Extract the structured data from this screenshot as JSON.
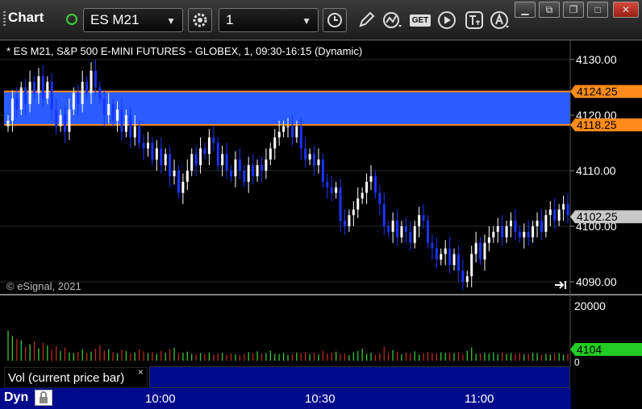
{
  "toolbar": {
    "title": "Chart",
    "symbol": "ES M21",
    "interval": "1",
    "icons": [
      "gear-icon",
      "clock-icon",
      "pencil-icon",
      "study-icon",
      "get-icon",
      "play-icon",
      "text-icon",
      "alert-icon"
    ],
    "get_label": "GET"
  },
  "chart_header": "* ES M21, S&P 500 E-MINI FUTURES - GLOBEX, 1, 09:30-16:15 (Dynamic)",
  "watermark": "© eSignal, 2021",
  "price_axis": [
    "4130.00",
    "4120.00",
    "4110.00",
    "4100.00",
    "4090.00"
  ],
  "price_tags": {
    "upper": "4124.25",
    "lower": "4118.25",
    "last": "4102.25"
  },
  "volume_axis": {
    "top": "20000",
    "zero": "0",
    "last": "4104"
  },
  "volume_panel_label": "Vol (current price bar)",
  "close_glyph": "×",
  "bottom": {
    "mode": "Dyn",
    "times": [
      "10:00",
      "10:30",
      "11:00"
    ]
  },
  "colors": {
    "band": "#2a5cff",
    "band_line": "#ff8c1a",
    "up": "#ffffff",
    "down": "#1a33ff",
    "vol_up": "#39c93a",
    "vol_down": "#c0281e",
    "last_tag": "#c8c8c8",
    "vol_tag": "#22cc22"
  },
  "chart_data": {
    "type": "candlestick",
    "ylim": [
      4088,
      4133
    ],
    "band": [
      4118.25,
      4124.25
    ],
    "volume_ylim": [
      0,
      20000
    ],
    "closes": [
      4119,
      4123,
      4121,
      4125,
      4122,
      4126,
      4124,
      4127,
      4123,
      4126,
      4121,
      4118,
      4120,
      4117,
      4121,
      4124,
      4122,
      4126,
      4124,
      4128,
      4125,
      4123,
      4120,
      4122,
      4119,
      4121,
      4117,
      4120,
      4116,
      4118,
      4115,
      4114,
      4115,
      4112,
      4114,
      4111,
      4113,
      4109,
      4110,
      4106,
      4108,
      4110,
      4113,
      4111,
      4114,
      4113,
      4116,
      4115,
      4111,
      4113,
      4110,
      4109,
      4112,
      4110,
      4108,
      4111,
      4109,
      4111,
      4110,
      4112,
      4114,
      4116,
      4117,
      4118,
      4118,
      4116,
      4118,
      4114,
      4112,
      4113,
      4111,
      4112,
      4108,
      4107,
      4106,
      4107,
      4101,
      4100,
      4102,
      4103,
      4105,
      4106,
      4108,
      4109,
      4106,
      4104,
      4100,
      4099,
      4101,
      4098,
      4100,
      4099,
      4097,
      4100,
      4102,
      4101,
      4097,
      4096,
      4094,
      4095,
      4096,
      4093,
      4095,
      4092,
      4090,
      4091,
      4095,
      4097,
      4094,
      4097,
      4098,
      4099,
      4100,
      4098,
      4100,
      4101,
      4099,
      4098,
      4099,
      4098,
      4100,
      4101,
      4099,
      4102,
      4103,
      4101,
      4103,
      4104,
      4102
    ],
    "volumes": [
      11000,
      9000,
      8000,
      7500,
      5000,
      6000,
      7000,
      4500,
      6500,
      5500,
      4000,
      5200,
      3600,
      4800,
      3000,
      2800,
      3200,
      4200,
      2900,
      3300,
      4400,
      5600,
      3800,
      4200,
      3100,
      2700,
      3900,
      3500,
      2600,
      3000,
      4100,
      3400,
      2800,
      3200,
      2500,
      3600,
      2900,
      4100,
      4700,
      2600,
      2900,
      3300,
      2500,
      2200,
      2800,
      2400,
      3000,
      2300,
      2600,
      2900,
      2200,
      2700,
      2300,
      2100,
      2400,
      3100,
      2600,
      3400,
      2500,
      2800,
      3600,
      2500,
      2400,
      2900,
      2100,
      2300,
      3000,
      2600,
      3200,
      2400,
      2800,
      2300,
      3700,
      2600,
      2900,
      3300,
      2400,
      2600,
      2100,
      3000,
      3500,
      4400,
      2500,
      2900,
      2100,
      2700,
      5000,
      2600,
      3900,
      3200,
      2400,
      2900,
      2500,
      3400,
      2200,
      2600,
      3200,
      2800,
      2600,
      3000,
      2800,
      2900,
      2700,
      3100,
      2300,
      3600,
      4800,
      2500,
      2700,
      2900,
      2600,
      3100,
      2400,
      3000,
      2500,
      2800,
      2500,
      2900,
      2400,
      2500,
      2900,
      2800,
      2100,
      2500,
      2300,
      2700,
      2800,
      2200,
      2500
    ]
  }
}
